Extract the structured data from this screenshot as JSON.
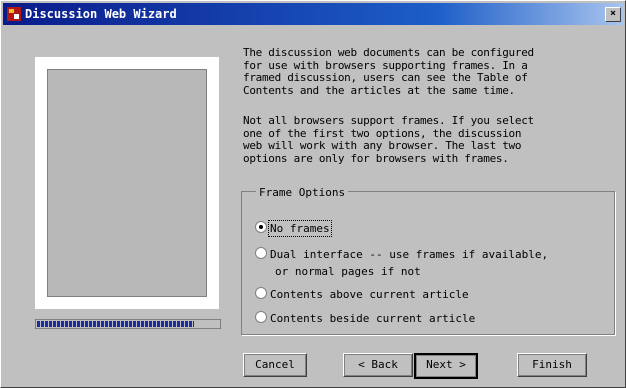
{
  "window": {
    "title": "Discussion Web Wizard",
    "close_glyph": "×"
  },
  "description": {
    "paragraph1": "The discussion web documents can be configured\nfor use with browsers supporting frames. In a\nframed discussion, users can see the Table of\nContents and the articles at the same time.",
    "paragraph2": "Not all browsers support frames. If you select\none of the first two options, the discussion\nweb will work with any browser. The last two\noptions are only for browsers with frames."
  },
  "frame_options": {
    "legend": "Frame Options",
    "options": [
      {
        "label": "No frames",
        "checked": true
      },
      {
        "label": "Dual interface -- use frames if available,",
        "continuation": "or normal pages if not",
        "checked": false
      },
      {
        "label": "Contents above current article",
        "checked": false
      },
      {
        "label": "Contents beside current article",
        "checked": false
      }
    ]
  },
  "progress": {
    "fraction": 0.86
  },
  "buttons": {
    "cancel": "Cancel",
    "back": "< Back",
    "next": "Next >",
    "finish": "Finish"
  },
  "colors": {
    "titlebar_start": "#0a1b8a",
    "titlebar_end": "#a8c4ee",
    "progress": "#1a2ca0"
  }
}
